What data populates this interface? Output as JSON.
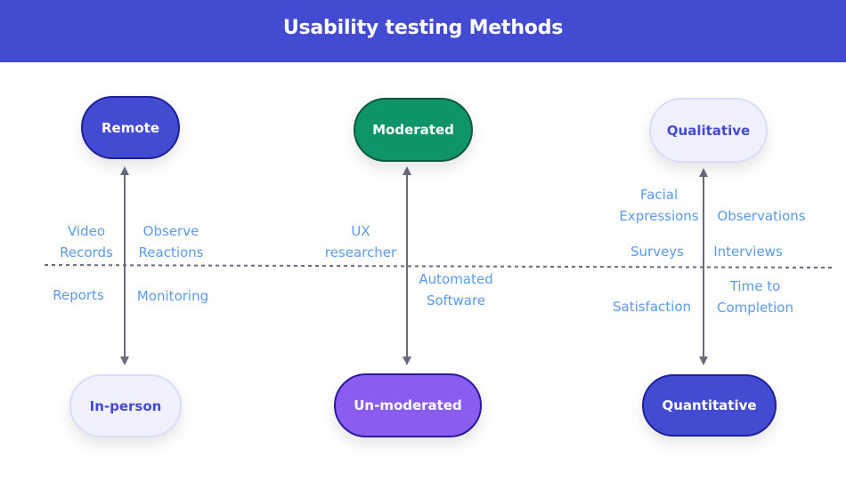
{
  "header": {
    "title": "Usability testing Methods"
  },
  "colors": {
    "header_bg": "#434bd3",
    "label_text": "#5a9bea",
    "arrow": "#6b6b80",
    "remote_fill": "#434bd3",
    "moderated_fill": "#0e9468",
    "unmoderated_fill": "#8a5cf0",
    "light_fill": "#f1f1fe"
  },
  "columns": [
    {
      "top": {
        "label": "Remote",
        "style": "blue"
      },
      "bottom": {
        "label": "In-person",
        "style": "light"
      },
      "above_left": "Video\nRecords",
      "above_right": "Observe\nReactions",
      "below_left": "Reports",
      "below_right": "Monitoring"
    },
    {
      "top": {
        "label": "Moderated",
        "style": "green"
      },
      "bottom": {
        "label": "Un-moderated",
        "style": "purple"
      },
      "above_left": "UX\nresearcher",
      "below_right": "Automated\nSoftware"
    },
    {
      "top": {
        "label": "Qualitative",
        "style": "light"
      },
      "bottom": {
        "label": "Quantitative",
        "style": "blue"
      },
      "above_left_1": "Facial\nExpressions",
      "above_right_1": "Observations",
      "above_left_2": "Surveys",
      "above_right_2": "Interviews",
      "below_left": "Satisfaction",
      "below_right": "Time to\nCompletion"
    }
  ]
}
